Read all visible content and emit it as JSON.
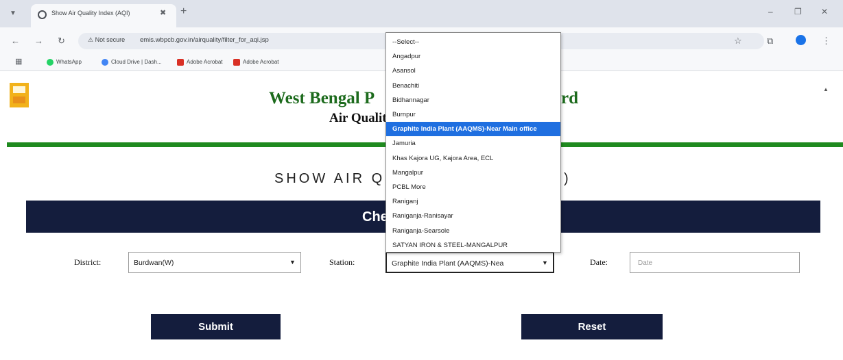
{
  "browser": {
    "tab_title": "Show Air Quality Index (AQI)",
    "tab_close": "✖",
    "new_tab": "+",
    "security_label": "⚠ Not secure",
    "url": "emis.wbpcb.gov.in/airquality/filter_for_aqi.jsp",
    "bookmarks": [
      "WhatsApp",
      "Cloud Drive | Dash...",
      "Adobe Acrobat",
      "Adobe Acrobat"
    ]
  },
  "header": {
    "title": "West Bengal P",
    "title_end": "rd",
    "subtitle": "Air Qualit"
  },
  "page": {
    "heading": "SHOW AIR Q",
    "heading_end": ")",
    "bar_text": "Che"
  },
  "form": {
    "district_label": "District:",
    "district_value": "Burdwan(W)",
    "station_label": "Station:",
    "station_value": "Graphite India Plant (AAQMS)-Nea",
    "date_label": "Date:",
    "date_placeholder": "Date",
    "submit_label": "Submit",
    "reset_label": "Reset"
  },
  "dropdown": {
    "selected_index": 7,
    "options": [
      "--Select--",
      "Angadpur",
      "Asansol",
      "Benachiti",
      "Bidhannagar",
      "Burnpur",
      "Graphite India Plant (AAQMS)-Near Main office",
      "Jamuria",
      "Khas Kajora UG, Kajora Area, ECL",
      "Mangalpur",
      "PCBL More",
      "Raniganj",
      "Raniganja-Ranisayar",
      "Raniganja-Searsole",
      "SATYAN IRON & STEEL-MANGALPUR"
    ]
  },
  "colors": {
    "brand_green": "#1d6b1d",
    "navy": "#141d3d",
    "highlight": "#1f6fe0"
  }
}
